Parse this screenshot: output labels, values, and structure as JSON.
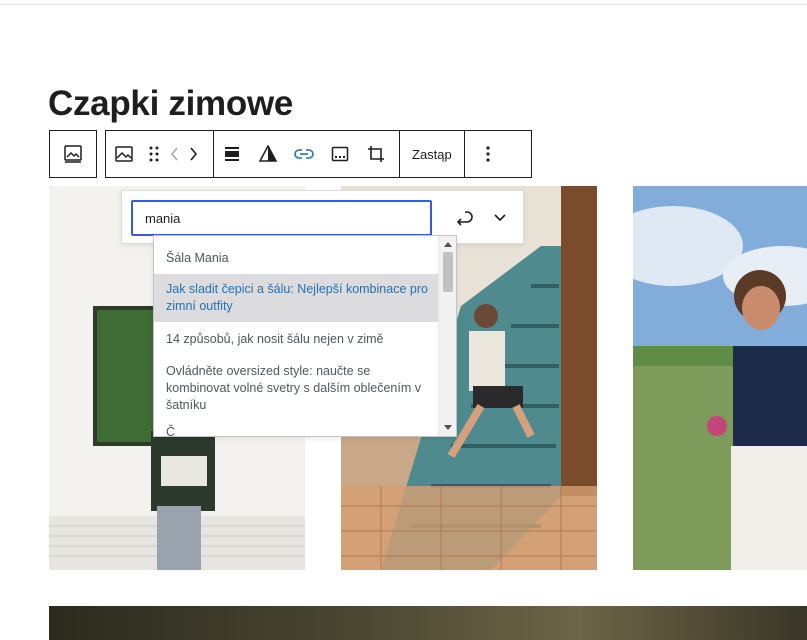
{
  "page": {
    "heading": "Czapki zimowe"
  },
  "toolbar": {
    "replace_label": "Zastąp",
    "icons": [
      "image-block-icon",
      "image-icon",
      "drag-handle-icon",
      "move-left-icon",
      "move-right-icon",
      "align-icon",
      "duotone-icon",
      "link-icon",
      "caption-icon",
      "crop-icon",
      "more-options-icon"
    ]
  },
  "link_popover": {
    "input_value": "mania",
    "submit_icon": "enter-return-icon",
    "toggle_icon": "chevron-down-icon"
  },
  "suggestions": [
    {
      "label": "Šála Mania",
      "selected": false
    },
    {
      "label": "Jak sladit čepici a šálu: Nejlepší kombinace pro zimní outfity",
      "selected": true
    },
    {
      "label": "14 způsobů, jak nosit šálu nejen v zimě",
      "selected": false
    },
    {
      "label": "Ovládněte oversized style: naučte se kombinovat volné svetry s dalším oblečením v šatníku",
      "selected": false
    },
    {
      "label": "Č",
      "selected": false
    }
  ]
}
